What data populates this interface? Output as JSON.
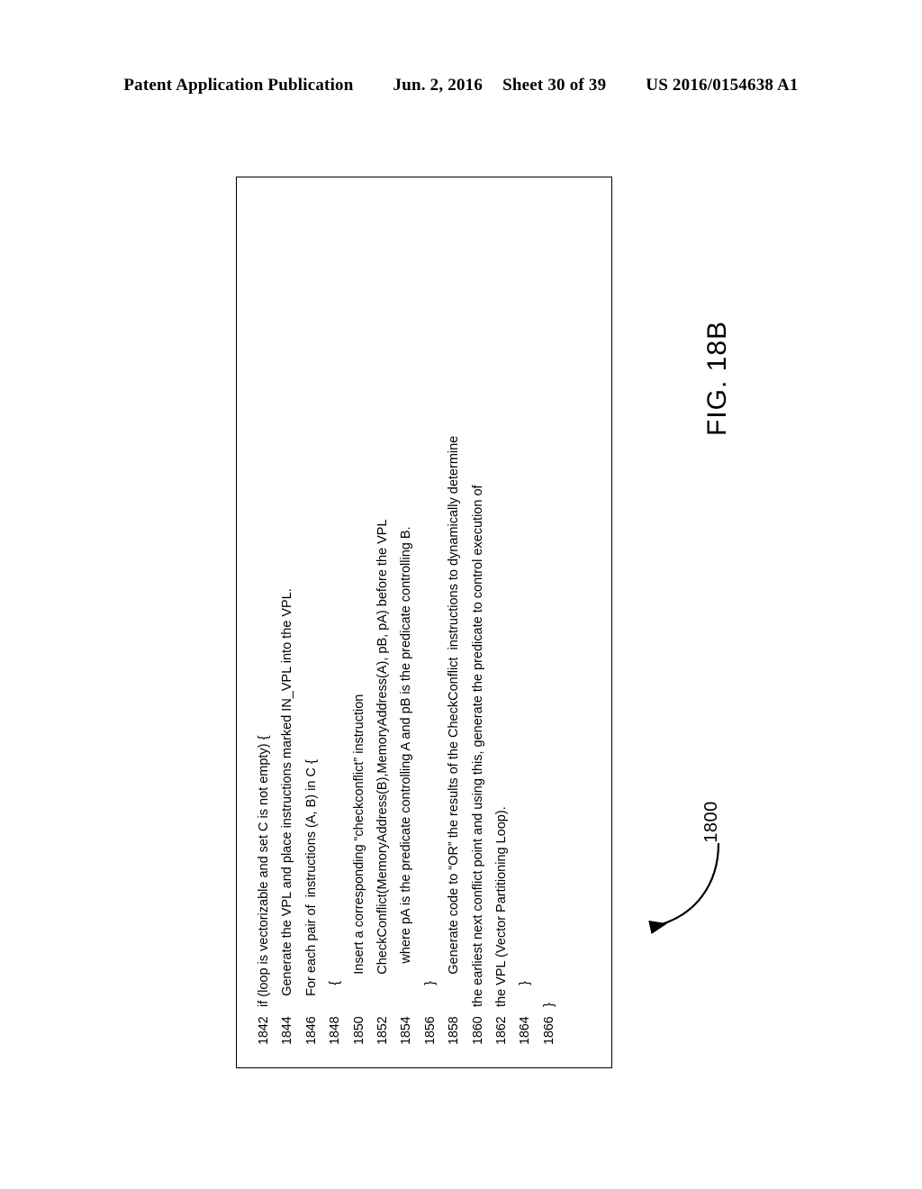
{
  "header": {
    "publication": "Patent Application Publication",
    "date": "Jun. 2, 2016",
    "sheet": "Sheet 30 of 39",
    "doc_number": "US 2016/0154638 A1"
  },
  "figure": {
    "label": "FIG. 18B",
    "reference_numeral": "1800",
    "arrow": "curved-leader-arrow",
    "code_listing": [
      {
        "num": "1842",
        "text": "if (loop is vectorizable and set C is not empty) {"
      },
      {
        "num": "1844",
        "text": "   Generate the VPL and place instructions marked IN_VPL into the VPL."
      },
      {
        "num": "1846",
        "text": "   For each pair of  instructions (A, B) in C {"
      },
      {
        "num": "1848",
        "text": "      {"
      },
      {
        "num": "1850",
        "text": "         Insert a corresponding “checkconflict” instruction"
      },
      {
        "num": "1852",
        "text": "         CheckConflict(MemoryAddress(B),MemoryAddress(A), pB, pA) before the VPL"
      },
      {
        "num": "1854",
        "text": "            where pA is the predicate controlling A and pB is the predicate controlling B."
      },
      {
        "num": "1856",
        "text": "      }"
      },
      {
        "num": "1858",
        "text": "         Generate code to “OR” the results of the CheckConflict  instructions to dynamically determine"
      },
      {
        "num": "1860",
        "text": "the earliest next conflict point and using this, generate the predicate to control execution of"
      },
      {
        "num": "1862",
        "text": "the VPL (Vector Partitioning Loop)."
      },
      {
        "num": "1864",
        "text": "      }"
      },
      {
        "num": "1866",
        "text": "}"
      }
    ]
  }
}
